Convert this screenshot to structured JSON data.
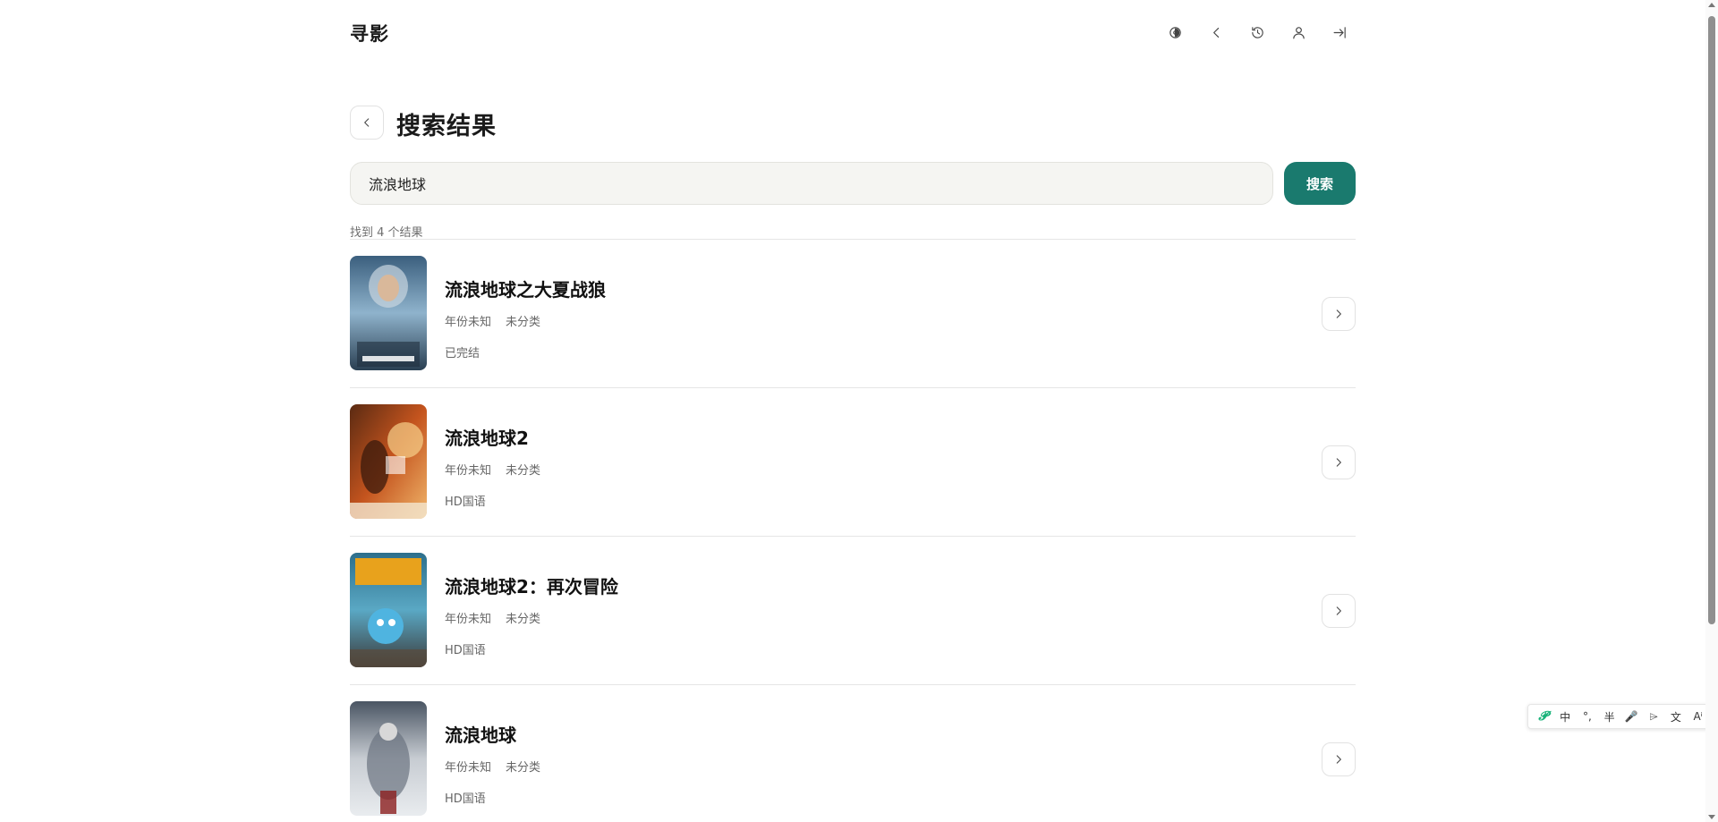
{
  "header": {
    "brand": "寻影",
    "icons": [
      "theme-toggle-icon",
      "chevron-left-icon",
      "history-icon",
      "user-icon",
      "logout-icon"
    ]
  },
  "page": {
    "title": "搜索结果"
  },
  "search": {
    "query": "流浪地球",
    "button_label": "搜索"
  },
  "results_summary": "找到 4 个结果",
  "results": [
    {
      "title": "流浪地球之大夏战狼",
      "year": "年份未知",
      "category": "未分类",
      "status": "已完结"
    },
    {
      "title": "流浪地球2",
      "year": "年份未知",
      "category": "未分类",
      "status": "HD国语"
    },
    {
      "title": "流浪地球2：再次冒险",
      "year": "年份未知",
      "category": "未分类",
      "status": "HD国语"
    },
    {
      "title": "流浪地球",
      "year": "年份未知",
      "category": "未分类",
      "status": "HD国语"
    }
  ],
  "ime_toolbar": {
    "items": [
      "𝓟",
      "中",
      "°,",
      "半",
      "🎤",
      "⌲",
      "文",
      "Aⁱ"
    ]
  },
  "colors": {
    "accent": "#1a7a6e",
    "input_bg": "#f5f5f2",
    "divider": "#e5e5e5"
  }
}
